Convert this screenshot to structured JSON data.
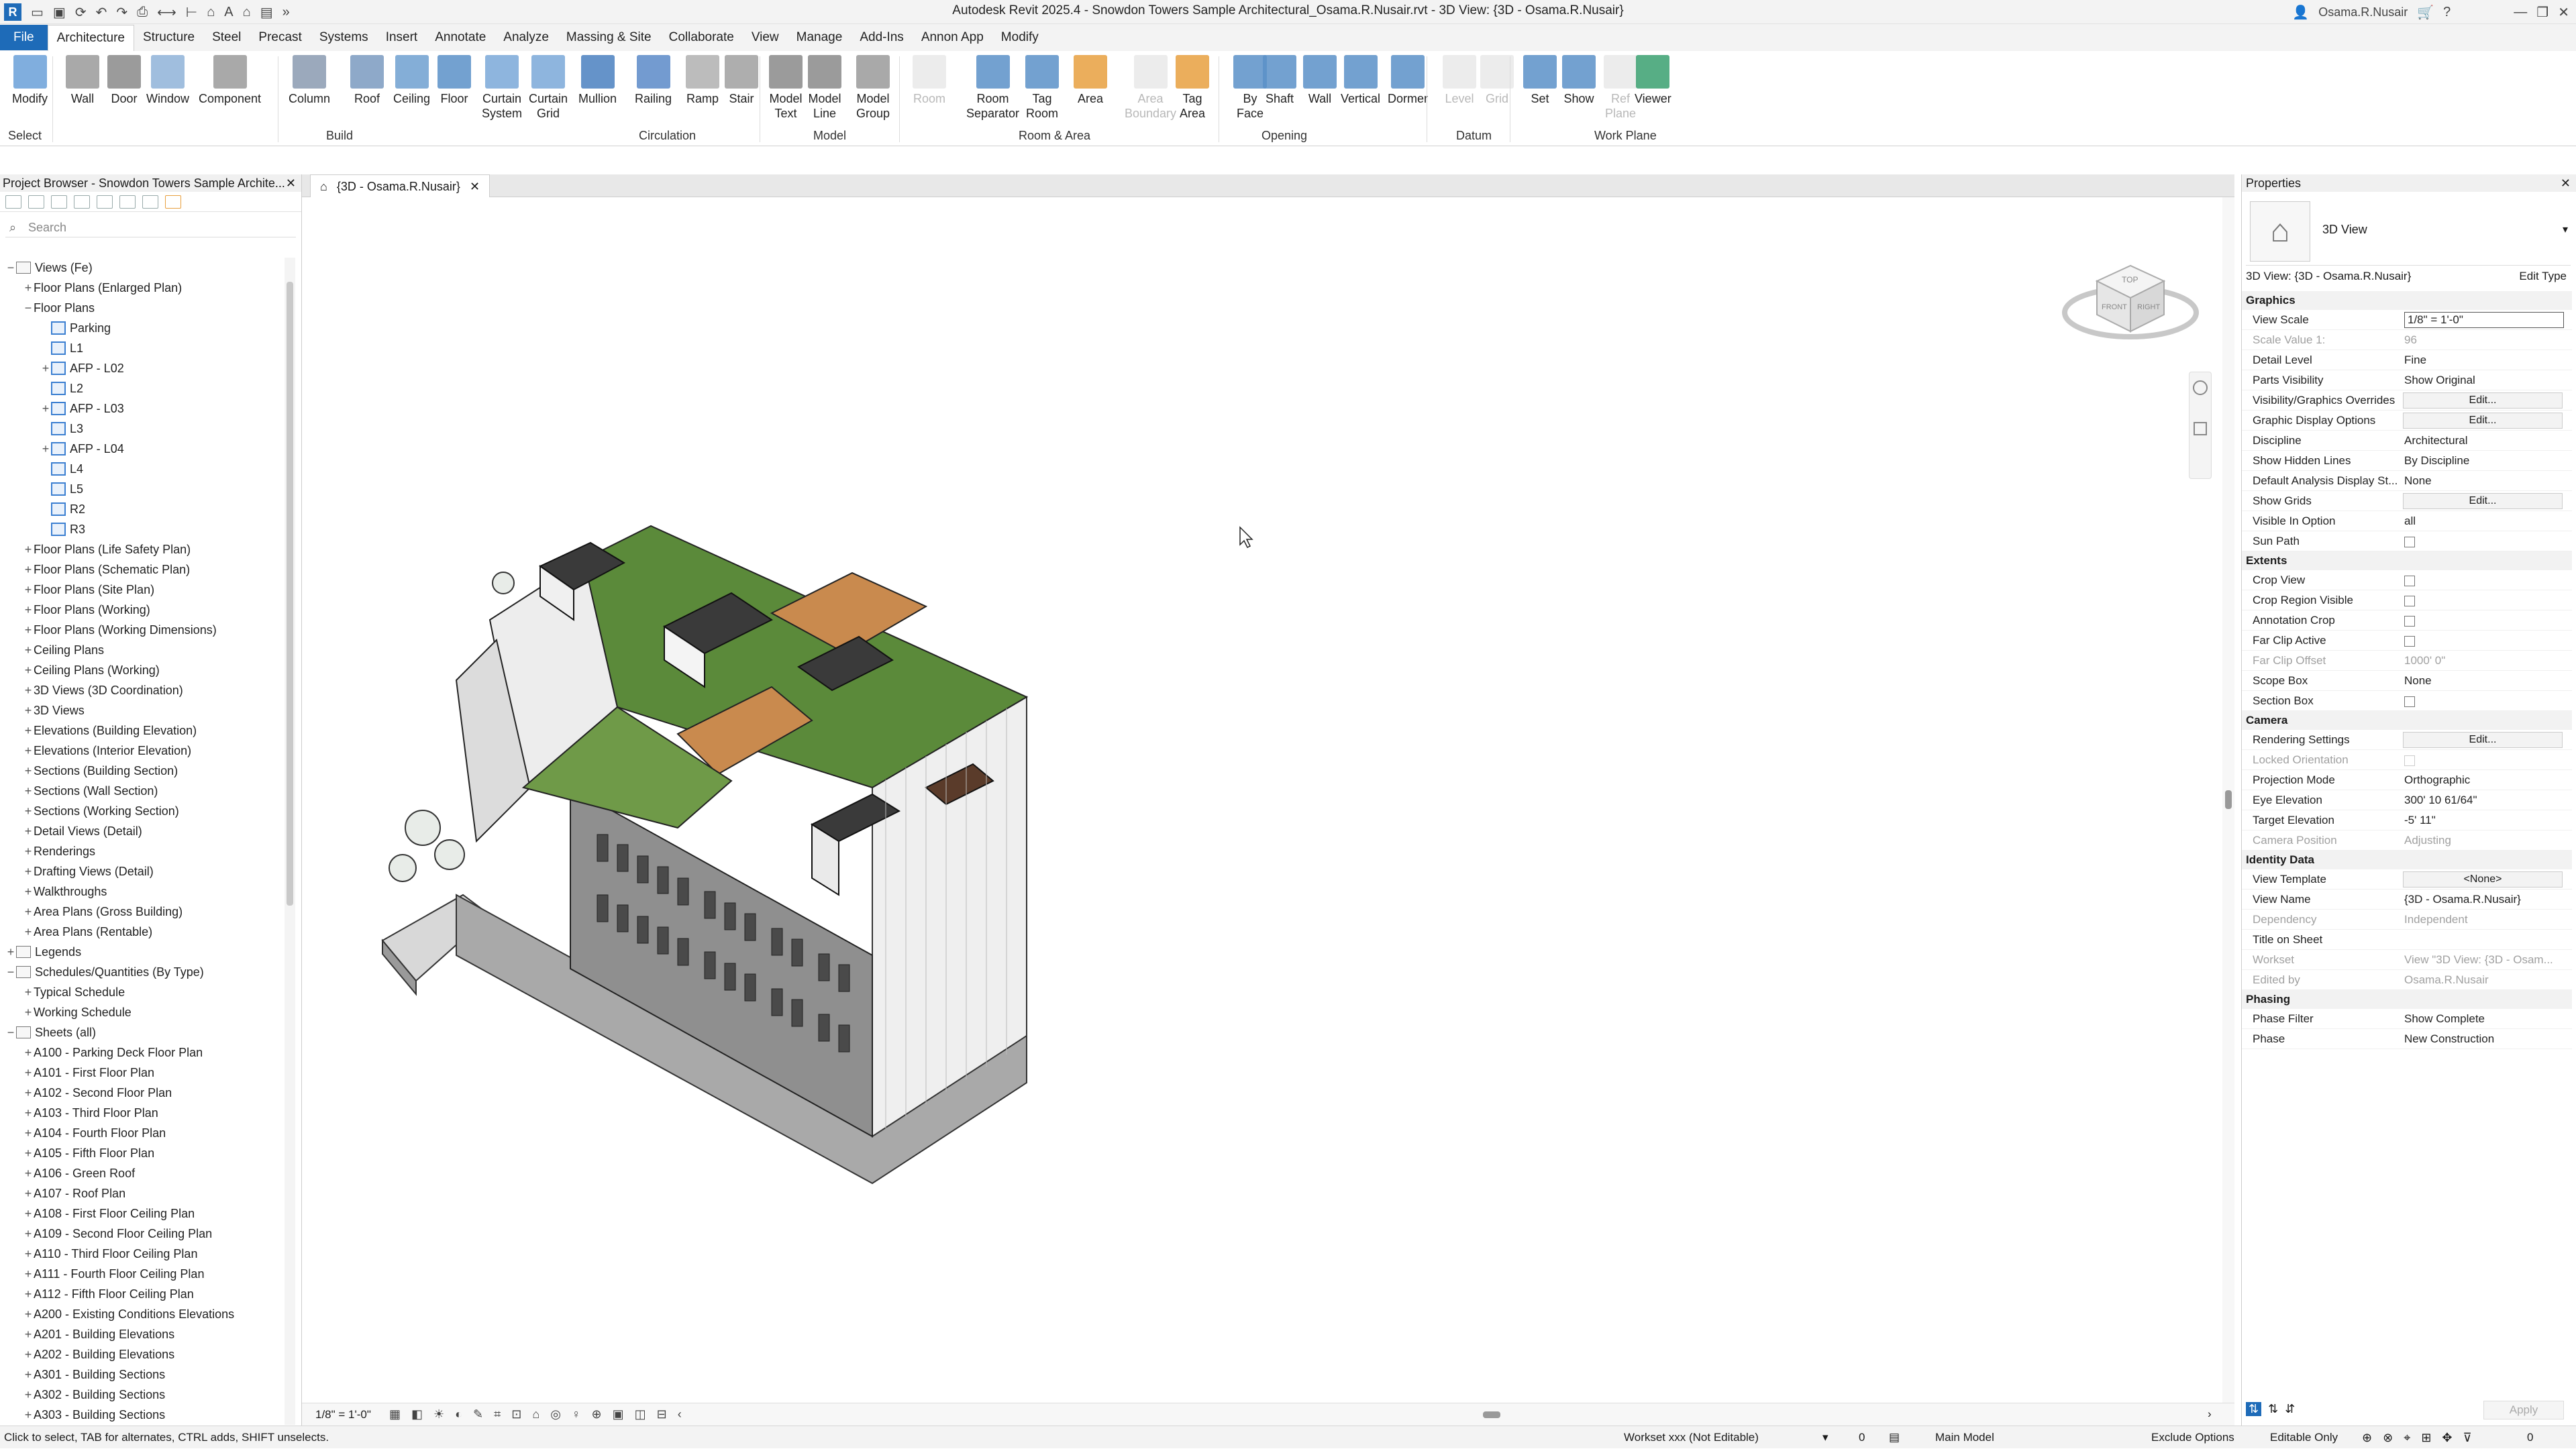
{
  "title": "Autodesk Revit 2025.4 - Snowdon Towers Sample Architectural_Osama.R.Nusair.rvt - 3D View: {3D - Osama.R.Nusair}",
  "user": "Osama.R.Nusair",
  "menu": [
    "File",
    "Architecture",
    "Structure",
    "Steel",
    "Precast",
    "Systems",
    "Insert",
    "Annotate",
    "Analyze",
    "Massing & Site",
    "Collaborate",
    "View",
    "Manage",
    "Add-Ins",
    "Annon App",
    "Modify"
  ],
  "ribbon": {
    "buttons": [
      {
        "label": "Modify",
        "sub": "",
        "dim": false
      },
      {
        "label": "Wall",
        "sub": "",
        "dim": false
      },
      {
        "label": "Door",
        "sub": "",
        "dim": false
      },
      {
        "label": "Window",
        "sub": "",
        "dim": false
      },
      {
        "label": "Component",
        "sub": "",
        "dim": false
      },
      {
        "label": "Column",
        "sub": "",
        "dim": false
      },
      {
        "label": "Roof",
        "sub": "",
        "dim": false
      },
      {
        "label": "Ceiling",
        "sub": "",
        "dim": false
      },
      {
        "label": "Floor",
        "sub": "",
        "dim": false
      },
      {
        "label": "Curtain",
        "sub": "System",
        "dim": false
      },
      {
        "label": "Curtain",
        "sub": "Grid",
        "dim": false
      },
      {
        "label": "Mullion",
        "sub": "",
        "dim": false
      },
      {
        "label": "Railing",
        "sub": "",
        "dim": false
      },
      {
        "label": "Ramp",
        "sub": "",
        "dim": false
      },
      {
        "label": "Stair",
        "sub": "",
        "dim": false
      },
      {
        "label": "Model",
        "sub": "Text",
        "dim": false
      },
      {
        "label": "Model",
        "sub": "Line",
        "dim": false
      },
      {
        "label": "Model",
        "sub": "Group",
        "dim": false
      },
      {
        "label": "Room",
        "sub": "",
        "dim": true
      },
      {
        "label": "Room",
        "sub": "Separator",
        "dim": false
      },
      {
        "label": "Tag",
        "sub": "Room",
        "dim": false
      },
      {
        "label": "Area",
        "sub": "",
        "dim": false
      },
      {
        "label": "Area",
        "sub": "Boundary",
        "dim": true
      },
      {
        "label": "Tag",
        "sub": "Area",
        "dim": false
      },
      {
        "label": "By",
        "sub": "Face",
        "dim": false
      },
      {
        "label": "Shaft",
        "sub": "",
        "dim": false
      },
      {
        "label": "Wall",
        "sub": "",
        "dim": false
      },
      {
        "label": "Vertical",
        "sub": "",
        "dim": false
      },
      {
        "label": "Dormer",
        "sub": "",
        "dim": false
      },
      {
        "label": "Level",
        "sub": "",
        "dim": true
      },
      {
        "label": "Grid",
        "sub": "",
        "dim": true
      },
      {
        "label": "Set",
        "sub": "",
        "dim": false
      },
      {
        "label": "Show",
        "sub": "",
        "dim": false
      },
      {
        "label": "Ref",
        "sub": "Plane",
        "dim": true
      },
      {
        "label": "Viewer",
        "sub": "",
        "dim": false
      }
    ],
    "panels": [
      "Select",
      "Build",
      "Circulation",
      "Model",
      "Room & Area",
      "Opening",
      "Datum",
      "Work Plane"
    ]
  },
  "view_tab": "{3D - Osama.R.Nusair}",
  "project_browser": {
    "title": "Project Browser - Snowdon Towers Sample Archite...",
    "search_placeholder": "Search",
    "items": [
      {
        "label": "Views (Fe)",
        "level": 0,
        "ex": "−",
        "icon": "group"
      },
      {
        "label": "Floor Plans (Enlarged Plan)",
        "level": 1,
        "ex": "+",
        "icon": ""
      },
      {
        "label": "Floor Plans",
        "level": 1,
        "ex": "−",
        "icon": ""
      },
      {
        "label": "Parking",
        "level": 2,
        "ex": "",
        "icon": "plan"
      },
      {
        "label": "L1",
        "level": 2,
        "ex": "",
        "icon": "plan"
      },
      {
        "label": "AFP - L02",
        "level": 2,
        "ex": "+",
        "icon": "plan"
      },
      {
        "label": "L2",
        "level": 2,
        "ex": "",
        "icon": "plan"
      },
      {
        "label": "AFP - L03",
        "level": 2,
        "ex": "+",
        "icon": "plan"
      },
      {
        "label": "L3",
        "level": 2,
        "ex": "",
        "icon": "plan"
      },
      {
        "label": "AFP - L04",
        "level": 2,
        "ex": "+",
        "icon": "plan"
      },
      {
        "label": "L4",
        "level": 2,
        "ex": "",
        "icon": "plan"
      },
      {
        "label": "L5",
        "level": 2,
        "ex": "",
        "icon": "plan"
      },
      {
        "label": "R2",
        "level": 2,
        "ex": "",
        "icon": "plan"
      },
      {
        "label": "R3",
        "level": 2,
        "ex": "",
        "icon": "plan"
      },
      {
        "label": "Floor Plans (Life Safety Plan)",
        "level": 1,
        "ex": "+",
        "icon": ""
      },
      {
        "label": "Floor Plans (Schematic Plan)",
        "level": 1,
        "ex": "+",
        "icon": ""
      },
      {
        "label": "Floor Plans (Site Plan)",
        "level": 1,
        "ex": "+",
        "icon": ""
      },
      {
        "label": "Floor Plans (Working)",
        "level": 1,
        "ex": "+",
        "icon": ""
      },
      {
        "label": "Floor Plans (Working Dimensions)",
        "level": 1,
        "ex": "+",
        "icon": ""
      },
      {
        "label": "Ceiling Plans",
        "level": 1,
        "ex": "+",
        "icon": ""
      },
      {
        "label": "Ceiling Plans (Working)",
        "level": 1,
        "ex": "+",
        "icon": ""
      },
      {
        "label": "3D Views (3D Coordination)",
        "level": 1,
        "ex": "+",
        "icon": ""
      },
      {
        "label": "3D Views",
        "level": 1,
        "ex": "+",
        "icon": ""
      },
      {
        "label": "Elevations (Building Elevation)",
        "level": 1,
        "ex": "+",
        "icon": ""
      },
      {
        "label": "Elevations (Interior Elevation)",
        "level": 1,
        "ex": "+",
        "icon": ""
      },
      {
        "label": "Sections (Building Section)",
        "level": 1,
        "ex": "+",
        "icon": ""
      },
      {
        "label": "Sections (Wall Section)",
        "level": 1,
        "ex": "+",
        "icon": ""
      },
      {
        "label": "Sections (Working Section)",
        "level": 1,
        "ex": "+",
        "icon": ""
      },
      {
        "label": "Detail Views (Detail)",
        "level": 1,
        "ex": "+",
        "icon": ""
      },
      {
        "label": "Renderings",
        "level": 1,
        "ex": "+",
        "icon": ""
      },
      {
        "label": "Drafting Views (Detail)",
        "level": 1,
        "ex": "+",
        "icon": ""
      },
      {
        "label": "Walkthroughs",
        "level": 1,
        "ex": "+",
        "icon": ""
      },
      {
        "label": "Area Plans (Gross Building)",
        "level": 1,
        "ex": "+",
        "icon": ""
      },
      {
        "label": "Area Plans (Rentable)",
        "level": 1,
        "ex": "+",
        "icon": ""
      },
      {
        "label": "Legends",
        "level": 0,
        "ex": "+",
        "icon": "group"
      },
      {
        "label": "Schedules/Quantities (By Type)",
        "level": 0,
        "ex": "−",
        "icon": "group"
      },
      {
        "label": "Typical Schedule",
        "level": 1,
        "ex": "+",
        "icon": ""
      },
      {
        "label": "Working Schedule",
        "level": 1,
        "ex": "+",
        "icon": ""
      },
      {
        "label": "Sheets (all)",
        "level": 0,
        "ex": "−",
        "icon": "group"
      },
      {
        "label": "A100 - Parking Deck Floor Plan",
        "level": 1,
        "ex": "+",
        "icon": ""
      },
      {
        "label": "A101 - First Floor Plan",
        "level": 1,
        "ex": "+",
        "icon": ""
      },
      {
        "label": "A102 - Second Floor Plan",
        "level": 1,
        "ex": "+",
        "icon": ""
      },
      {
        "label": "A103 - Third Floor Plan",
        "level": 1,
        "ex": "+",
        "icon": ""
      },
      {
        "label": "A104 - Fourth Floor Plan",
        "level": 1,
        "ex": "+",
        "icon": ""
      },
      {
        "label": "A105 - Fifth Floor Plan",
        "level": 1,
        "ex": "+",
        "icon": ""
      },
      {
        "label": "A106 - Green Roof",
        "level": 1,
        "ex": "+",
        "icon": ""
      },
      {
        "label": "A107 - Roof Plan",
        "level": 1,
        "ex": "+",
        "icon": ""
      },
      {
        "label": "A108 - First Floor Ceiling Plan",
        "level": 1,
        "ex": "+",
        "icon": ""
      },
      {
        "label": "A109 - Second Floor Ceiling Plan",
        "level": 1,
        "ex": "+",
        "icon": ""
      },
      {
        "label": "A110 - Third Floor Ceiling Plan",
        "level": 1,
        "ex": "+",
        "icon": ""
      },
      {
        "label": "A111 - Fourth Floor Ceiling Plan",
        "level": 1,
        "ex": "+",
        "icon": ""
      },
      {
        "label": "A112 - Fifth Floor Ceiling Plan",
        "level": 1,
        "ex": "+",
        "icon": ""
      },
      {
        "label": "A200 - Existing Conditions Elevations",
        "level": 1,
        "ex": "+",
        "icon": ""
      },
      {
        "label": "A201 - Building Elevations",
        "level": 1,
        "ex": "+",
        "icon": ""
      },
      {
        "label": "A202 - Building Elevations",
        "level": 1,
        "ex": "+",
        "icon": ""
      },
      {
        "label": "A301 - Building Sections",
        "level": 1,
        "ex": "+",
        "icon": ""
      },
      {
        "label": "A302 - Building Sections",
        "level": 1,
        "ex": "+",
        "icon": ""
      },
      {
        "label": "A303 - Building Sections",
        "level": 1,
        "ex": "+",
        "icon": ""
      }
    ]
  },
  "viewcube": {
    "top": "TOP",
    "front": "FRONT",
    "right": "RIGHT"
  },
  "view_scale_label": "1/8\" = 1'-0\"",
  "properties": {
    "title": "Properties",
    "type_name": "3D View",
    "instance": "3D View: {3D - Osama.R.Nusair}",
    "edit_type": "Edit Type",
    "apply": "Apply",
    "sections": [
      {
        "name": "Graphics",
        "rows": [
          {
            "k": "View Scale",
            "v": "1/8\" = 1'-0\"",
            "t": "input"
          },
          {
            "k": "Scale Value    1:",
            "v": "96",
            "t": "dim"
          },
          {
            "k": "Detail Level",
            "v": "Fine",
            "t": "text"
          },
          {
            "k": "Parts Visibility",
            "v": "Show Original",
            "t": "text"
          },
          {
            "k": "Visibility/Graphics Overrides",
            "v": "Edit...",
            "t": "btn"
          },
          {
            "k": "Graphic Display Options",
            "v": "Edit...",
            "t": "btn"
          },
          {
            "k": "Discipline",
            "v": "Architectural",
            "t": "text"
          },
          {
            "k": "Show Hidden Lines",
            "v": "By Discipline",
            "t": "text"
          },
          {
            "k": "Default Analysis Display St...",
            "v": "None",
            "t": "text"
          },
          {
            "k": "Show Grids",
            "v": "Edit...",
            "t": "btn"
          },
          {
            "k": "Visible In Option",
            "v": "all",
            "t": "text"
          },
          {
            "k": "Sun Path",
            "v": "",
            "t": "cb"
          }
        ]
      },
      {
        "name": "Extents",
        "rows": [
          {
            "k": "Crop View",
            "v": "",
            "t": "cb"
          },
          {
            "k": "Crop Region Visible",
            "v": "",
            "t": "cb"
          },
          {
            "k": "Annotation Crop",
            "v": "",
            "t": "cb"
          },
          {
            "k": "Far Clip Active",
            "v": "",
            "t": "cb"
          },
          {
            "k": "Far Clip Offset",
            "v": "1000'  0\"",
            "t": "dim"
          },
          {
            "k": "Scope Box",
            "v": "None",
            "t": "text"
          },
          {
            "k": "Section Box",
            "v": "",
            "t": "cb"
          }
        ]
      },
      {
        "name": "Camera",
        "rows": [
          {
            "k": "Rendering Settings",
            "v": "Edit...",
            "t": "btn"
          },
          {
            "k": "Locked Orientation",
            "v": "",
            "t": "cbdim"
          },
          {
            "k": "Projection Mode",
            "v": "Orthographic",
            "t": "text"
          },
          {
            "k": "Eye Elevation",
            "v": "300'  10 61/64\"",
            "t": "text"
          },
          {
            "k": "Target Elevation",
            "v": "-5'  11\"",
            "t": "text"
          },
          {
            "k": "Camera Position",
            "v": "Adjusting",
            "t": "dim"
          }
        ]
      },
      {
        "name": "Identity Data",
        "rows": [
          {
            "k": "View Template",
            "v": "<None>",
            "t": "btn"
          },
          {
            "k": "View Name",
            "v": "{3D - Osama.R.Nusair}",
            "t": "text"
          },
          {
            "k": "Dependency",
            "v": "Independent",
            "t": "dim"
          },
          {
            "k": "Title on Sheet",
            "v": "",
            "t": "text"
          },
          {
            "k": "Workset",
            "v": "View \"3D View: {3D - Osam...",
            "t": "dim"
          },
          {
            "k": "Edited by",
            "v": "Osama.R.Nusair",
            "t": "dim"
          }
        ]
      },
      {
        "name": "Phasing",
        "rows": [
          {
            "k": "Phase Filter",
            "v": "Show Complete",
            "t": "text"
          },
          {
            "k": "Phase",
            "v": "New Construction",
            "t": "text"
          }
        ]
      }
    ]
  },
  "statusbar": {
    "hint": "Click to select, TAB for alternates, CTRL adds, SHIFT unselects.",
    "workset": "Workset xxx (Not Editable)",
    "count": "0",
    "model": "Main Model",
    "exclude": "Exclude Options",
    "editable": "Editable Only",
    "filter": "0"
  },
  "colors": {
    "accent": "#1e6bb8",
    "grass": "#5b8a3a",
    "wood": "#c98a4e"
  }
}
